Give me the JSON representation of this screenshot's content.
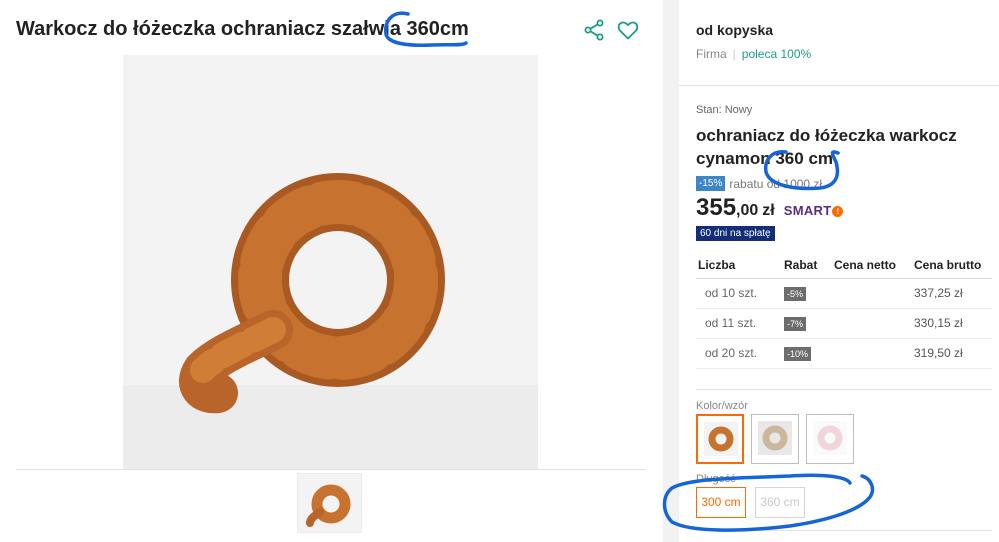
{
  "product": {
    "title": "Warkocz do łóżeczka ochraniacz szałwia 360cm"
  },
  "icons": {
    "share": "share-icon",
    "favorite": "heart-icon"
  },
  "seller": {
    "name": "od kopyska",
    "type": "Firma",
    "recommend": "poleca 100%"
  },
  "offer": {
    "condition": "Stan: Nowy",
    "title": "ochraniacz do łóżeczka warkocz cynamon 360 cm",
    "discount_badge": "-15%",
    "discount_text": "rabatu od 1000 zł",
    "price_main": "355",
    "price_cents": ",00",
    "currency": "zł",
    "smart_label": "SMART",
    "smart_mark": "!",
    "pay_later": "60 dni na spłatę"
  },
  "tiers": {
    "headers": [
      "Liczba",
      "Rabat",
      "Cena netto",
      "Cena brutto"
    ],
    "rows": [
      {
        "qty": "od 10 szt.",
        "discount": "-5%",
        "net": "",
        "gross": "337,25 zł"
      },
      {
        "qty": "od 11 szt.",
        "discount": "-7%",
        "net": "",
        "gross": "330,15 zł"
      },
      {
        "qty": "od 20 szt.",
        "discount": "-10%",
        "net": "",
        "gross": "319,50 zł"
      }
    ]
  },
  "variants": {
    "color_label": "Kolor/wzór",
    "length_label": "Długość",
    "lengths": [
      "300 cm",
      "360 cm"
    ],
    "selected_length": "300 cm"
  },
  "colors": {
    "accent": "#ff6a00",
    "teal": "#1a9e8c",
    "product_orange": "#c8722f",
    "annotation_blue": "#1565d8"
  }
}
